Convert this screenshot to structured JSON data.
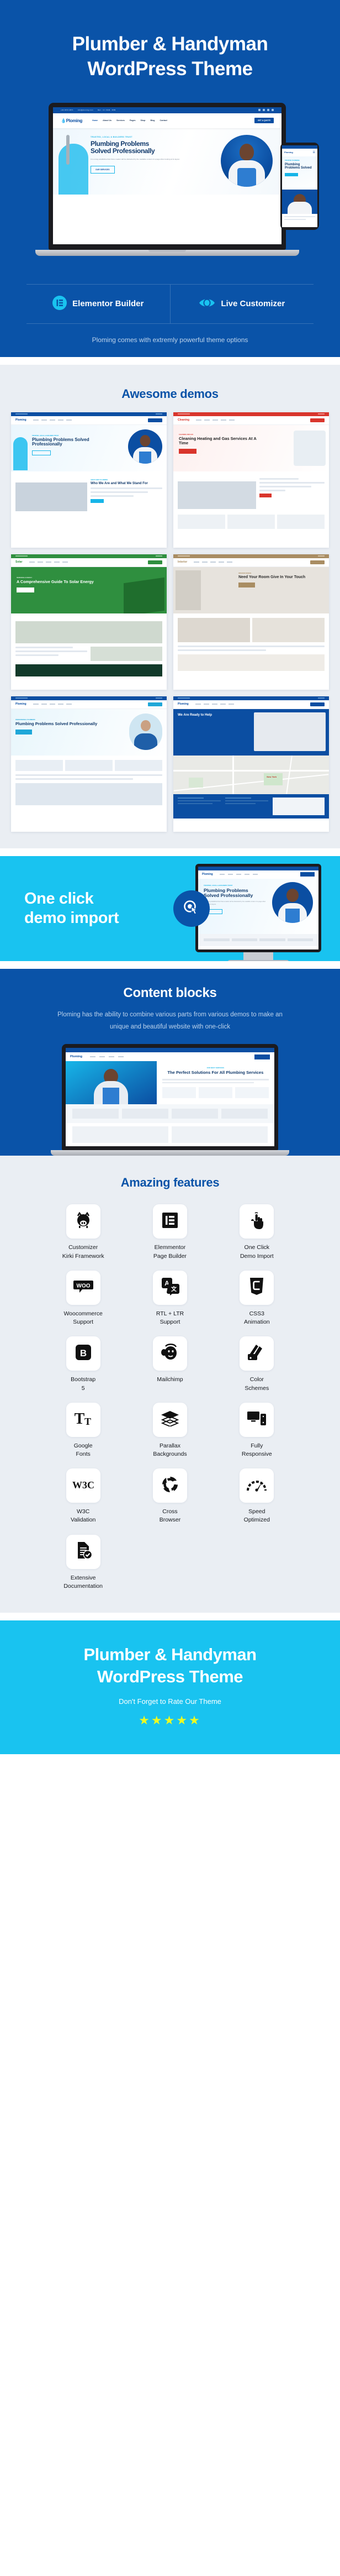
{
  "hero": {
    "title_line1": "Plumber & Handyman",
    "title_line2": "WordPress Theme",
    "features": [
      {
        "icon": "elementor-icon",
        "label": "Elementor Builder"
      },
      {
        "icon": "eye-icon",
        "label": "Live Customizer"
      }
    ],
    "subtitle": "Ploming comes with extremly powerful theme options",
    "bg_color": "#0a53a8"
  },
  "mock_site": {
    "topbar_items": [
      "+92 2972 2871",
      "info@ploming.com",
      "Mon - Fri: 8AM - 6PM"
    ],
    "logo": "Ploming",
    "logo_tagline": "Plumbing Services",
    "menu": [
      "Home",
      "About Us",
      "Services",
      "Pages",
      "Shop",
      "Blog",
      "Contact"
    ],
    "cta": "GET A QUOTE",
    "eyebrow": "TRUSTED, LOCAL & BUILDERS TRUST",
    "heading_line1": "Plumbing Problems",
    "heading_line2": "Solved Professionally",
    "paragraph": "It is a long established fact that a reader will be distracted by the readable content of a page when looking at its layout.",
    "button": "OUR SERVICES"
  },
  "demos": {
    "title": "Awesome demos",
    "items": [
      {
        "name": "demo-plumbing-main",
        "accent": "#0b4ea2",
        "heading": "Plumbing Problems Solved Professionally"
      },
      {
        "name": "demo-cleaning-gas",
        "accent": "#d9352c",
        "heading": "Cleaning Heating and Gas Services At A Time"
      },
      {
        "name": "demo-solar-energy",
        "accent": "#2f8f3f",
        "heading": "A Comprehensive Guide To Solar Energy"
      },
      {
        "name": "demo-interior-room",
        "accent": "#a98d63",
        "heading": "Need Your Room Give In Your Touch"
      },
      {
        "name": "demo-handyman",
        "accent": "#1fa7d8",
        "heading": "Plumbing Problems Solved Professionally"
      },
      {
        "name": "demo-contact-map",
        "accent": "#0b4ea2",
        "heading": "We Are Ready to Help"
      }
    ]
  },
  "oneclick": {
    "title_line1": "One click",
    "title_line2": "demo import",
    "icon": "click-cursor-icon",
    "bg_color": "#19c3f0"
  },
  "content_blocks": {
    "title": "Content blocks",
    "paragraph": "Ploming has the ability to combine various parts from various demos to make an unique and beautiful website with one-click"
  },
  "features": {
    "title": "Amazing features",
    "items": [
      {
        "icon": "kirki-pig-icon",
        "label_line1": "Customizer",
        "label_line2": "Kirki Framework"
      },
      {
        "icon": "elementor-icon",
        "label_line1": "Elemmentor",
        "label_line2": "Page Builder"
      },
      {
        "icon": "click-hand-icon",
        "label_line1": "One Click",
        "label_line2": "Demo Import"
      },
      {
        "icon": "woocommerce-icon",
        "label_line1": "Woocommerce",
        "label_line2": "Support"
      },
      {
        "icon": "translate-icon",
        "label_line1": "RTL + LTR",
        "label_line2": "Support"
      },
      {
        "icon": "css3-icon",
        "label_line1": "CSS3",
        "label_line2": "Animation"
      },
      {
        "icon": "bootstrap-icon",
        "label_line1": "Bootstrap",
        "label_line2": "5"
      },
      {
        "icon": "mailchimp-icon",
        "label_line1": "Mailchimp",
        "label_line2": ""
      },
      {
        "icon": "color-swatch-icon",
        "label_line1": "Color",
        "label_line2": "Schemes"
      },
      {
        "icon": "google-fonts-icon",
        "label_line1": "Google",
        "label_line2": "Fonts"
      },
      {
        "icon": "layers-icon",
        "label_line1": "Parallax",
        "label_line2": "Backgrounds"
      },
      {
        "icon": "responsive-devices-icon",
        "label_line1": "Fully",
        "label_line2": "Responsive"
      },
      {
        "icon": "w3c-icon",
        "label_line1": "W3C",
        "label_line2": "Validation"
      },
      {
        "icon": "cross-browser-icon",
        "label_line1": "Cross",
        "label_line2": "Browser"
      },
      {
        "icon": "speedometer-icon",
        "label_line1": "Speed",
        "label_line2": "Optimized"
      },
      {
        "icon": "document-check-icon",
        "label_line1": "Extensive",
        "label_line2": "Documentation"
      }
    ]
  },
  "footer": {
    "title_line1": "Plumber & Handyman",
    "title_line2": "WordPress Theme",
    "rate_text": "Don't Forget to Rate Our Theme",
    "stars": "★★★★★",
    "star_color": "#ecfa22",
    "bg_color": "#19c3f0"
  }
}
